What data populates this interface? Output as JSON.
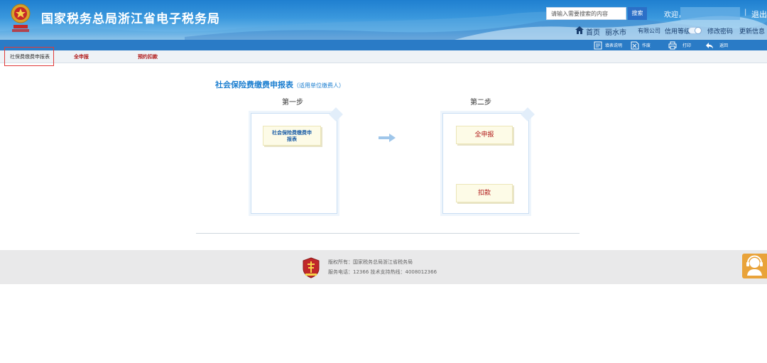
{
  "header": {
    "site_title": "国家税务总局浙江省电子税务局",
    "search_placeholder": "请输入需要搜索的内容",
    "search_button": "搜索",
    "welcome": "欢迎，",
    "separator": "|",
    "logout": "退出",
    "nav": {
      "home": "首页",
      "city": "丽水市",
      "company": "有限公司",
      "credit_level": "信用等级",
      "change_password": "修改密码",
      "update_info": "更新信息"
    }
  },
  "toolbar": {
    "items": [
      {
        "label": "填表说明",
        "icon": "document-icon"
      },
      {
        "label": "作废",
        "icon": "void-icon"
      },
      {
        "label": "打印",
        "icon": "print-icon"
      },
      {
        "label": "返回",
        "icon": "back-arrow-icon"
      }
    ]
  },
  "tabs": [
    {
      "label": "社保费缴费申报表",
      "state": "active"
    },
    {
      "label": "全申报",
      "state": "link"
    },
    {
      "label": "预约扣款",
      "state": "link"
    }
  ],
  "main": {
    "heading": "社会保险费缴费申报表",
    "heading_note": "（适用单位缴费人）",
    "step1": {
      "label": "第一步",
      "button": "社会保险费缴费申报表"
    },
    "step2": {
      "label": "第二步",
      "button_declare": "全申报",
      "button_deduct": "扣款"
    }
  },
  "footer": {
    "copyright": "版权所有：国家税务总局浙江省税务局",
    "hotline": "服务电话：12366 技术支持热线：4008012366"
  },
  "colors": {
    "header_blue": "#2a7bc6",
    "heading_blue": "#1d7fd0",
    "tab_red": "#b01818",
    "highlight_red": "#e03a3a",
    "support_orange": "#e9a33a"
  }
}
